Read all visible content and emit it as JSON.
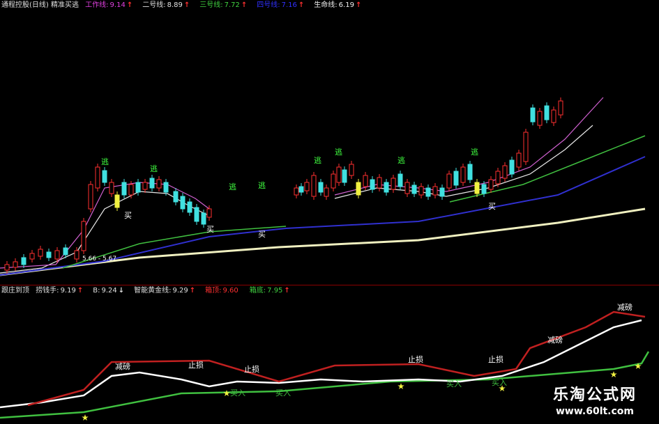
{
  "top_legend": {
    "title": "通程控股(日线) 精准买逃",
    "items": [
      {
        "label": "工作线:",
        "value": "9.14",
        "arrow": "↑",
        "color": "#e040e0",
        "arrow_color": "#ff3030"
      },
      {
        "label": "二号线:",
        "value": "8.89",
        "arrow": "↑",
        "color": "#e0e0e0",
        "arrow_color": "#ff3030"
      },
      {
        "label": "三号线:",
        "value": "7.72",
        "arrow": "↑",
        "color": "#40d040",
        "arrow_color": "#ff3030"
      },
      {
        "label": "四号线:",
        "value": "7.16",
        "arrow": "↑",
        "color": "#3030ff",
        "arrow_color": "#ff3030"
      },
      {
        "label": "生命线:",
        "value": "6.19",
        "arrow": "↑",
        "color": "#f0f0f0",
        "arrow_color": "#ff3030"
      }
    ]
  },
  "bottom_legend": {
    "title": "跟庄到顶",
    "items": [
      {
        "label": "捞钱手:",
        "value": "9.19",
        "arrow": "↑",
        "color": "#e0e0e0",
        "arrow_color": "#ff3030"
      },
      {
        "label": "B:",
        "value": "9.24",
        "arrow": "↓",
        "color": "#e0e0e0",
        "arrow_color": "#e0e0e0"
      },
      {
        "label": "智能黄金线:",
        "value": "9.29",
        "arrow": "↑",
        "color": "#e0e0e0",
        "arrow_color": "#ff3030"
      },
      {
        "label": "箱顶:",
        "value": "9.60",
        "arrow": "",
        "color": "#ff3030",
        "arrow_color": "#ff3030"
      },
      {
        "label": "箱底:",
        "value": "7.95",
        "arrow": "↑",
        "color": "#40d040",
        "arrow_color": "#ff3030"
      }
    ]
  },
  "chart_labels": {
    "escape": "逃",
    "buy": "买",
    "buy_in": "买入",
    "stop_loss": "止损",
    "reduce": "减磅",
    "price_range": "5.66 - 5.67"
  },
  "watermark": {
    "cn": "乐淘公式网",
    "url": "www.60lt.com"
  },
  "colors": {
    "up": "#ff3030",
    "down": "#40e0e0",
    "ma_work": "#d060d0",
    "ma_two": "#e8e8e8",
    "ma_three": "#40c040",
    "ma_four": "#3030d0",
    "life": "#f0f0c0",
    "yellow": "#f0f040"
  }
}
